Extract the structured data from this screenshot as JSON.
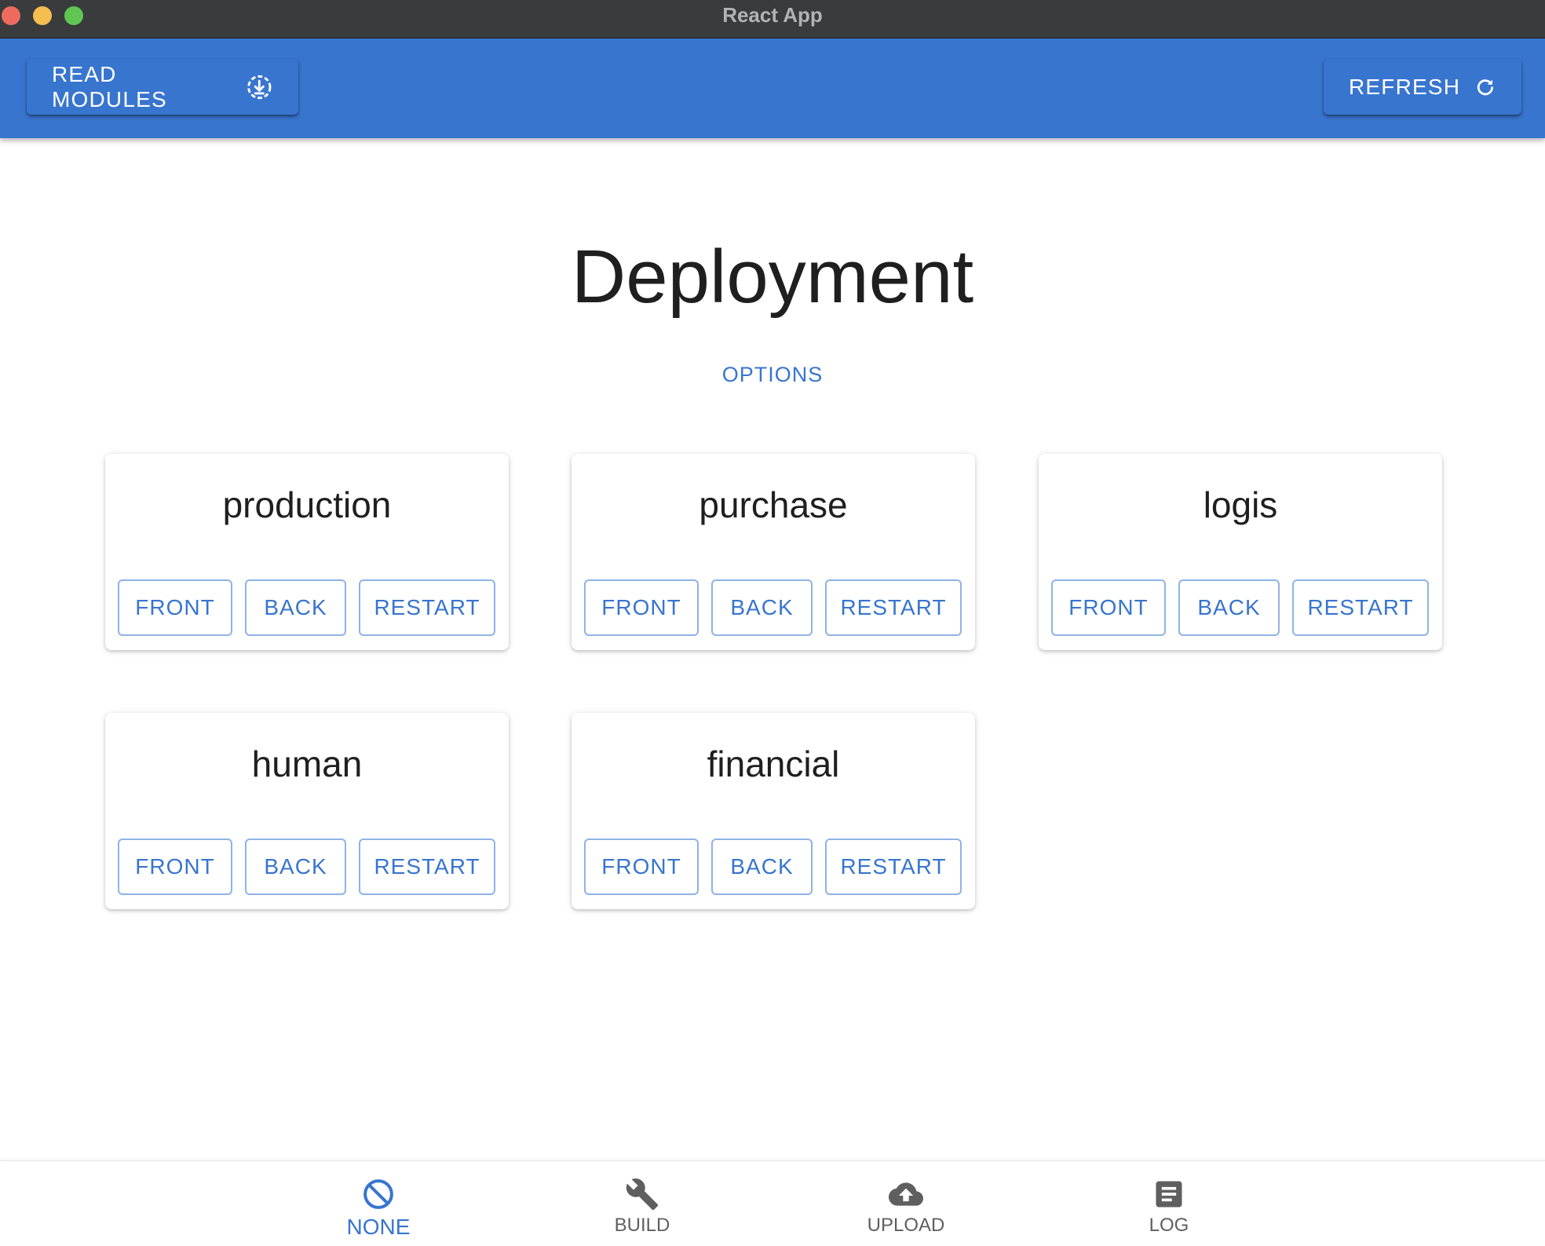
{
  "window": {
    "title": "React App"
  },
  "appbar": {
    "read_modules_label": "READ MODULES",
    "refresh_label": "REFRESH"
  },
  "main": {
    "title": "Deployment",
    "options_label": "OPTIONS"
  },
  "modules": [
    {
      "name": "production",
      "front": "FRONT",
      "back": "BACK",
      "restart": "RESTART"
    },
    {
      "name": "purchase",
      "front": "FRONT",
      "back": "BACK",
      "restart": "RESTART"
    },
    {
      "name": "logis",
      "front": "FRONT",
      "back": "BACK",
      "restart": "RESTART"
    },
    {
      "name": "human",
      "front": "FRONT",
      "back": "BACK",
      "restart": "RESTART"
    },
    {
      "name": "financial",
      "front": "FRONT",
      "back": "BACK",
      "restart": "RESTART"
    }
  ],
  "bottom_nav": {
    "items": [
      {
        "label": "NONE",
        "icon": "block-icon",
        "active": true
      },
      {
        "label": "BUILD",
        "icon": "wrench-icon",
        "active": false
      },
      {
        "label": "UPLOAD",
        "icon": "cloud-upload-icon",
        "active": false
      },
      {
        "label": "LOG",
        "icon": "document-icon",
        "active": false
      }
    ]
  },
  "colors": {
    "primary": "#3875cf",
    "titlebar": "#393b3d",
    "button_border": "#8fb3e6",
    "nav_inactive": "#5f5f5f"
  }
}
